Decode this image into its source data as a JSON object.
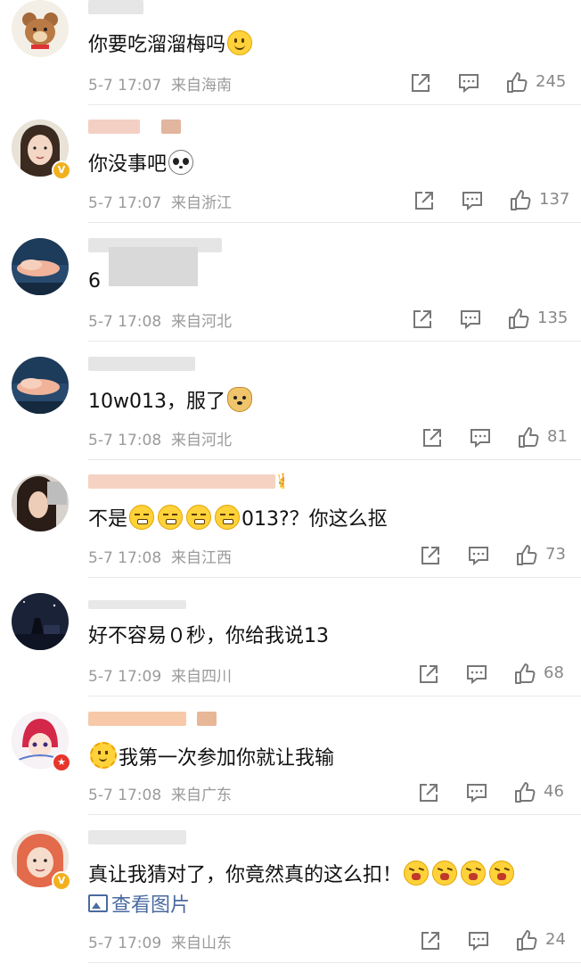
{
  "comments": [
    {
      "text_before": "你要吃溜溜梅吗",
      "emojis": [
        "smile"
      ],
      "text_after": "",
      "time": "5-7 17:07",
      "location": "来自海南",
      "likes": "245",
      "emoji_before": [],
      "avatar": "bear"
    },
    {
      "text_before": "你没事吧",
      "emojis": [
        "panda"
      ],
      "text_after": "",
      "time": "5-7 17:07",
      "location": "来自浙江",
      "likes": "137",
      "emoji_before": [],
      "avatar": "girl",
      "verified": true
    },
    {
      "text_before": "6",
      "emojis": [],
      "text_after": "",
      "time": "5-7 17:08",
      "location": "来自河北",
      "likes": "135",
      "emoji_before": [],
      "avatar": "sky"
    },
    {
      "text_before": "10w013，服了",
      "emojis": [
        "doge"
      ],
      "text_after": "",
      "time": "5-7 17:08",
      "location": "来自河北",
      "likes": "81",
      "emoji_before": [],
      "avatar": "sky"
    },
    {
      "text_before": "不是",
      "emojis": [
        "sweat",
        "sweat",
        "sweat",
        "sweat"
      ],
      "text_after": "013?？你这么抠",
      "time": "5-7 17:08",
      "location": "来自江西",
      "likes": "73",
      "emoji_before": [],
      "avatar": "hair"
    },
    {
      "text_before": "好不容易０秒，你给我说13",
      "emojis": [],
      "text_after": "",
      "time": "5-7 17:09",
      "location": "来自四川",
      "likes": "68",
      "emoji_before": [],
      "avatar": "night"
    },
    {
      "text_before": "我第一次参加你就让我输",
      "emojis": [],
      "text_after": "",
      "time": "5-7 17:08",
      "location": "来自广东",
      "likes": "46",
      "emoji_before": [
        "flower"
      ],
      "avatar": "anime",
      "red_badge": true
    },
    {
      "text_before": "真让我猜对了，你竟然真的这么扣！",
      "emojis": [
        "angry",
        "angry",
        "angry",
        "angry"
      ],
      "text_after": "",
      "time": "5-7 17:09",
      "location": "来自山东",
      "likes": "24",
      "emoji_before": [],
      "avatar": "hood",
      "verified": true,
      "see_image": "查看图片"
    }
  ],
  "colors": {
    "meta": "#9a9a9a",
    "link": "#4a6aa0",
    "username_bar": "#e0e0e0"
  },
  "icons": {
    "share": "share-icon",
    "comment": "comment-icon",
    "like": "thumbs-up-icon"
  }
}
